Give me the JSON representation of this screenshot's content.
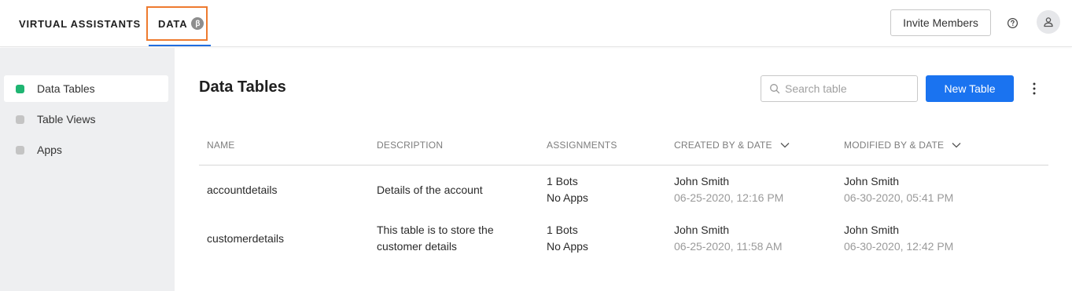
{
  "topnav": {
    "tabs": [
      {
        "label": "VIRTUAL ASSISTANTS"
      },
      {
        "label": "DATA",
        "badge": "β"
      }
    ],
    "invite_label": "Invite Members",
    "help_icon": "question-circle-icon",
    "avatar_icon": "user-icon"
  },
  "sidebar": {
    "items": [
      {
        "label": "Data Tables",
        "active": true
      },
      {
        "label": "Table Views",
        "active": false
      },
      {
        "label": "Apps",
        "active": false
      }
    ]
  },
  "main": {
    "title": "Data Tables",
    "search_placeholder": "Search table",
    "new_button_label": "New Table"
  },
  "table": {
    "columns": [
      "NAME",
      "DESCRIPTION",
      "ASSIGNMENTS",
      "CREATED BY & DATE",
      "MODIFIED BY & DATE"
    ],
    "rows": [
      {
        "name": "accountdetails",
        "description_lines": [
          "Details of the account"
        ],
        "bots": "1 Bots",
        "apps": "No Apps",
        "created_by": "John Smith",
        "created_date": "06-25-2020, 12:16 PM",
        "modified_by": "John Smith",
        "modified_date": "06-30-2020, 05:41 PM"
      },
      {
        "name": "customerdetails",
        "description_lines": [
          "This table is to store the",
          "customer details"
        ],
        "bots": "1 Bots",
        "apps": "No Apps",
        "created_by": "John Smith",
        "created_date": "06-25-2020, 11:58 AM",
        "modified_by": "John Smith",
        "modified_date": "06-30-2020, 12:42 PM"
      }
    ]
  },
  "colors": {
    "accent": "#1a73f0",
    "active_dot": "#1fb572",
    "highlight": "#ee7b2f"
  }
}
